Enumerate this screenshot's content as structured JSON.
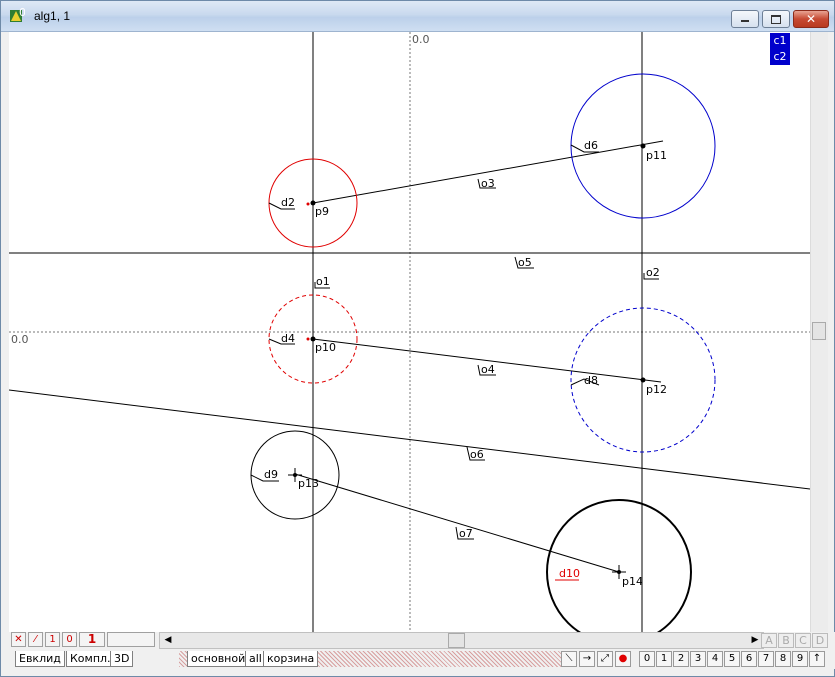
{
  "window": {
    "title": "alg1, 1"
  },
  "canvas": {
    "origin_x_label": "0.0",
    "origin_y_label": "0.0",
    "layers": [
      "c1",
      "c2"
    ],
    "labels": {
      "o1": "o1",
      "o2": "o2",
      "o3": "o3",
      "o4": "o4",
      "o5": "o5",
      "o6": "o6",
      "o7": "o7",
      "d2": "d2",
      "d4": "d4",
      "d6": "d6",
      "d8": "d8",
      "d9": "d9",
      "d10": "d10",
      "p9": "p9",
      "p10": "p10",
      "p11": "p11",
      "p12": "p12",
      "p13": "p13",
      "p14": "p14"
    },
    "colors": {
      "red": "#e00000",
      "blue": "#0000cc",
      "black": "#000000"
    }
  },
  "toolbar1": {
    "cross_label": "✕",
    "slash_label": "⁄",
    "one_label": "1",
    "zero_label": "0",
    "big_one_label": "1",
    "abcd": [
      "A",
      "B",
      "C",
      "D"
    ]
  },
  "tabs_left": [
    "Евклид",
    "Компл.",
    "3D"
  ],
  "tabs_mid": [
    "основной",
    "all",
    "корзина"
  ],
  "tool_icons": [
    "line-tool-icon",
    "arrow-right-icon",
    "diagonal-arrow-icon",
    "record-dot-icon"
  ],
  "digits": [
    "0",
    "1",
    "2",
    "3",
    "4",
    "5",
    "6",
    "7",
    "8",
    "9",
    "↑"
  ]
}
